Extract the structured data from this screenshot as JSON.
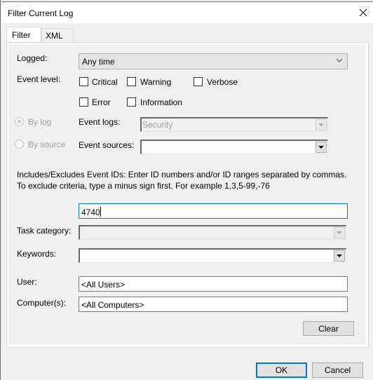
{
  "window": {
    "title": "Filter Current Log",
    "close_label": "×"
  },
  "tabs": [
    {
      "label": "Filter",
      "active": true
    },
    {
      "label": "XML",
      "active": false
    }
  ],
  "filter": {
    "logged": {
      "label": "Logged:",
      "value": "Any time"
    },
    "event_level": {
      "label": "Event level:",
      "options": [
        {
          "label": "Critical",
          "checked": false
        },
        {
          "label": "Warning",
          "checked": false
        },
        {
          "label": "Verbose",
          "checked": false
        },
        {
          "label": "Error",
          "checked": false
        },
        {
          "label": "Information",
          "checked": false
        }
      ]
    },
    "source_mode": {
      "by_log": {
        "label": "By log",
        "selected": true,
        "enabled": false
      },
      "by_source": {
        "label": "By source",
        "selected": false,
        "enabled": false
      }
    },
    "event_logs": {
      "label": "Event logs:",
      "value": "Security",
      "enabled": false
    },
    "event_sources": {
      "label": "Event sources:",
      "value": ""
    },
    "event_ids": {
      "description": "Includes/Excludes Event IDs: Enter ID numbers and/or ID ranges separated by commas. To exclude criteria, type a minus sign first. For example 1,3,5-99,-76",
      "value": "4740"
    },
    "task_category": {
      "label": "Task category:",
      "value": "",
      "enabled": false
    },
    "keywords": {
      "label": "Keywords:",
      "value": ""
    },
    "user": {
      "label": "User:",
      "value": "<All Users>"
    },
    "computers": {
      "label": "Computer(s):",
      "value": "<All Computers>"
    },
    "clear_label": "Clear"
  },
  "footer": {
    "ok_label": "OK",
    "cancel_label": "Cancel"
  }
}
